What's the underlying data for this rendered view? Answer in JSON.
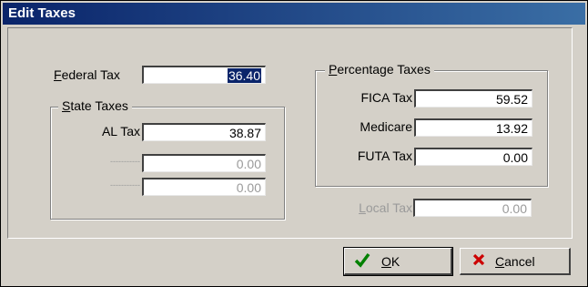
{
  "window": {
    "title": "Edit Taxes"
  },
  "federal": {
    "label_pre": "",
    "label_u": "F",
    "label_post": "ederal Tax",
    "value": "36.40"
  },
  "state": {
    "legend_u": "S",
    "legend_post": "tate Taxes",
    "rows": [
      {
        "label": "AL Tax",
        "value": "38.87",
        "enabled": true
      },
      {
        "label": "-----------",
        "value": "0.00",
        "enabled": false
      },
      {
        "label": "-----------",
        "value": "0.00",
        "enabled": false
      }
    ]
  },
  "percentage": {
    "legend_u": "P",
    "legend_post": "ercentage Taxes",
    "rows": [
      {
        "label": "FICA Tax",
        "value": "59.52"
      },
      {
        "label": "Medicare",
        "value": "13.92"
      },
      {
        "label": "FUTA Tax",
        "value": "0.00"
      }
    ]
  },
  "local": {
    "label_u": "L",
    "label_post": "ocal Tax",
    "value": "0.00"
  },
  "buttons": {
    "ok": {
      "label_u": "O",
      "label_post": "K",
      "icon": "check-icon",
      "icon_color": "#008000"
    },
    "cancel": {
      "label_u": "C",
      "label_post": "ancel",
      "icon": "x-icon",
      "icon_color": "#cc0000"
    }
  }
}
